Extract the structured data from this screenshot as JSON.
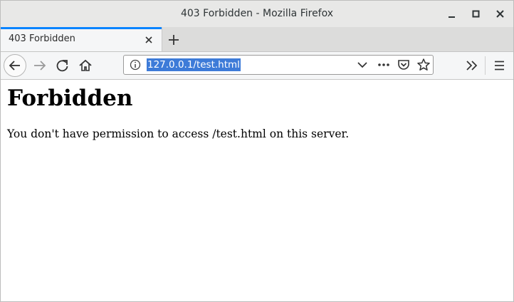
{
  "window": {
    "title": "403 Forbidden - Mozilla Firefox"
  },
  "tab": {
    "title": "403 Forbidden"
  },
  "urlbar": {
    "url": "127.0.0.1/test.html"
  },
  "page": {
    "heading": "Forbidden",
    "message": "You don't have permission to access /test.html on this server."
  },
  "colors": {
    "tab_accent": "#0a84ff",
    "url_selection": "#3d7bd8"
  }
}
